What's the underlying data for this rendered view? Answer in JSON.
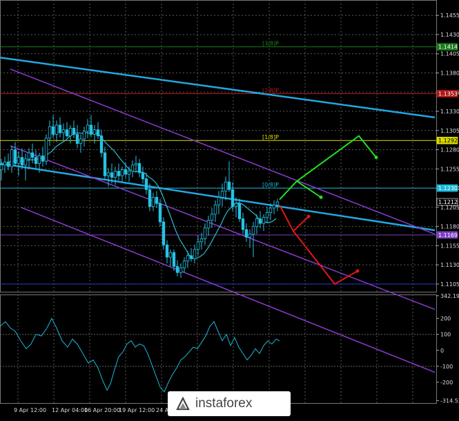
{
  "chart_data": [
    {
      "type": "candlestick",
      "symbol_hint": "EURUSD",
      "timeframe_hint": "H4",
      "grid": true,
      "ylim": [
        1.1095,
        1.1475
      ],
      "y_ticks": [
        "1.1455",
        "1.1430",
        "1.1405",
        "1.1380",
        "1.1355",
        "1.1330",
        "1.1305",
        "1.1280",
        "1.1255",
        "1.1230",
        "1.1205",
        "1.1180",
        "1.1155",
        "1.1130",
        "1.1105"
      ],
      "x_ticks": [
        "9 Apr 12:00",
        "12 Apr 04:00",
        "16 Apr 20:00",
        "19 Apr 12:00",
        "24 Apr"
      ],
      "price_badges": [
        {
          "value": "1.1414",
          "color": "#1a7a1a"
        },
        {
          "value": "1.1353",
          "color": "#b01818"
        },
        {
          "value": "1.1292",
          "color": "#d8d800"
        },
        {
          "value": "1.1230",
          "color": "#18b8d8"
        },
        {
          "value": "1.1212",
          "color": "#000000"
        },
        {
          "value": "1.1169",
          "color": "#7a3fc0"
        }
      ],
      "murray_labels": [
        {
          "text": "[3/8]P",
          "level": 1.1414,
          "color": "#1a8a1a"
        },
        {
          "text": "[2/8]P",
          "level": 1.1353,
          "color": "#c01818"
        },
        {
          "text": "[1/8]P",
          "level": 1.1292,
          "color": "#e0e000"
        },
        {
          "text": "[0/8]P",
          "level": 1.123,
          "color": "#1fb8d8"
        }
      ],
      "horizontal_levels": [
        {
          "value": 1.1414,
          "color": "#1a7a1a"
        },
        {
          "value": 1.1353,
          "color": "#c01818"
        },
        {
          "value": 1.1292,
          "color": "#e0e000"
        },
        {
          "value": 1.123,
          "color": "#18b8d8"
        },
        {
          "value": 1.1169,
          "color": "#7a3fc0"
        },
        {
          "value": 1.1105,
          "color": "#2233cc"
        }
      ],
      "trend_lines": [
        {
          "color": "#22a8e0",
          "from": [
            0,
            1.14
          ],
          "to": [
            630,
            1.1322
          ]
        },
        {
          "color": "#22a8e0",
          "from": [
            0,
            1.1262
          ],
          "to": [
            630,
            1.1175
          ]
        },
        {
          "color": "#8a3cd0",
          "from": [
            15,
            1.1385
          ],
          "to": [
            630,
            1.117
          ]
        },
        {
          "color": "#8a3cd0",
          "from": [
            15,
            1.1285
          ],
          "to": [
            630,
            1.1072
          ]
        },
        {
          "color": "#8a3cd0",
          "from": [
            30,
            1.1205
          ],
          "to": [
            630,
            1.099
          ]
        }
      ],
      "forecast_arrows": [
        {
          "color": "#22e022",
          "points": [
            [
              405,
              1.1215
            ],
            [
              430,
              1.1239
            ],
            [
              465,
              1.1218
            ]
          ]
        },
        {
          "color": "#22e022",
          "points": [
            [
              430,
              1.1239
            ],
            [
              520,
              1.1298
            ],
            [
              545,
              1.127
            ]
          ]
        },
        {
          "color": "#e01818",
          "points": [
            [
              405,
              1.1208
            ],
            [
              425,
              1.1174
            ],
            [
              447,
              1.1193
            ]
          ]
        },
        {
          "color": "#e01818",
          "points": [
            [
              425,
              1.1174
            ],
            [
              485,
              1.1105
            ],
            [
              518,
              1.1122
            ]
          ]
        }
      ],
      "candles": [
        [
          0,
          1.1254,
          1.1268,
          1.124,
          1.126
        ],
        [
          5,
          1.126,
          1.1271,
          1.125,
          1.1264
        ],
        [
          10,
          1.1264,
          1.1275,
          1.1253,
          1.1258
        ],
        [
          15,
          1.1258,
          1.1285,
          1.125,
          1.128
        ],
        [
          20,
          1.128,
          1.129,
          1.1258,
          1.1262
        ],
        [
          25,
          1.1262,
          1.1278,
          1.1246,
          1.127
        ],
        [
          30,
          1.127,
          1.1282,
          1.1255,
          1.126
        ],
        [
          35,
          1.126,
          1.1275,
          1.124,
          1.1268
        ],
        [
          40,
          1.1268,
          1.1282,
          1.1255,
          1.1276
        ],
        [
          45,
          1.1276,
          1.1288,
          1.1262,
          1.127
        ],
        [
          50,
          1.127,
          1.128,
          1.1255,
          1.1262
        ],
        [
          55,
          1.1262,
          1.1276,
          1.125,
          1.1272
        ],
        [
          60,
          1.1272,
          1.1284,
          1.1258,
          1.1265
        ],
        [
          65,
          1.1265,
          1.13,
          1.126,
          1.1295
        ],
        [
          70,
          1.1295,
          1.1318,
          1.1285,
          1.131
        ],
        [
          75,
          1.131,
          1.1325,
          1.1295,
          1.13
        ],
        [
          80,
          1.13,
          1.1318,
          1.129,
          1.1312
        ],
        [
          85,
          1.1312,
          1.1322,
          1.1296,
          1.1302
        ],
        [
          90,
          1.1302,
          1.1314,
          1.1292,
          1.1306
        ],
        [
          95,
          1.1306,
          1.1316,
          1.1296,
          1.1298
        ],
        [
          100,
          1.1298,
          1.1312,
          1.1288,
          1.1308
        ],
        [
          105,
          1.1308,
          1.1318,
          1.1295,
          1.13
        ],
        [
          110,
          1.13,
          1.1312,
          1.1282,
          1.1288
        ],
        [
          115,
          1.1288,
          1.13,
          1.1276,
          1.1294
        ],
        [
          120,
          1.1294,
          1.131,
          1.1284,
          1.1304
        ],
        [
          125,
          1.1304,
          1.132,
          1.1295,
          1.1312
        ],
        [
          130,
          1.1312,
          1.1325,
          1.1296,
          1.13
        ],
        [
          135,
          1.13,
          1.1312,
          1.1288,
          1.1306
        ],
        [
          140,
          1.1306,
          1.1316,
          1.1294,
          1.1298
        ],
        [
          145,
          1.1298,
          1.1306,
          1.127,
          1.1276
        ],
        [
          150,
          1.1276,
          1.1284,
          1.124,
          1.1246
        ],
        [
          155,
          1.1246,
          1.1256,
          1.1232,
          1.125
        ],
        [
          160,
          1.125,
          1.1262,
          1.1236,
          1.1244
        ],
        [
          165,
          1.1244,
          1.1258,
          1.1234,
          1.1252
        ],
        [
          170,
          1.1252,
          1.1262,
          1.124,
          1.1246
        ],
        [
          175,
          1.1246,
          1.1258,
          1.1238,
          1.1254
        ],
        [
          180,
          1.1254,
          1.1264,
          1.1242,
          1.1248
        ],
        [
          185,
          1.1248,
          1.1258,
          1.1238,
          1.1252
        ],
        [
          190,
          1.1252,
          1.1266,
          1.1244,
          1.126
        ],
        [
          195,
          1.126,
          1.1272,
          1.125,
          1.1262
        ],
        [
          200,
          1.1262,
          1.1268,
          1.1244,
          1.125
        ],
        [
          205,
          1.125,
          1.1258,
          1.1236,
          1.1242
        ],
        [
          210,
          1.1242,
          1.125,
          1.1222,
          1.1228
        ],
        [
          215,
          1.1228,
          1.1236,
          1.12,
          1.1206
        ],
        [
          220,
          1.1206,
          1.1224,
          1.12,
          1.1218
        ],
        [
          225,
          1.1218,
          1.1226,
          1.1204,
          1.121
        ],
        [
          230,
          1.121,
          1.1216,
          1.118,
          1.1186
        ],
        [
          235,
          1.1186,
          1.1192,
          1.115,
          1.1156
        ],
        [
          240,
          1.1156,
          1.1162,
          1.1132,
          1.114
        ],
        [
          245,
          1.114,
          1.115,
          1.1128,
          1.1146
        ],
        [
          250,
          1.1146,
          1.115,
          1.1122,
          1.1128
        ],
        [
          255,
          1.1128,
          1.1136,
          1.1115,
          1.112
        ],
        [
          260,
          1.112,
          1.1132,
          1.1113,
          1.1126
        ],
        [
          265,
          1.1126,
          1.114,
          1.112,
          1.1135
        ],
        [
          270,
          1.1135,
          1.1148,
          1.1126,
          1.1142
        ],
        [
          275,
          1.1142,
          1.1152,
          1.1134,
          1.1138
        ],
        [
          280,
          1.1138,
          1.1156,
          1.1132,
          1.115
        ],
        [
          285,
          1.115,
          1.1168,
          1.1142,
          1.116
        ],
        [
          290,
          1.116,
          1.1172,
          1.115,
          1.1164
        ],
        [
          295,
          1.1164,
          1.1184,
          1.1156,
          1.1178
        ],
        [
          300,
          1.1178,
          1.1194,
          1.1168,
          1.1188
        ],
        [
          305,
          1.1188,
          1.1204,
          1.1178,
          1.1196
        ],
        [
          310,
          1.1196,
          1.1214,
          1.1186,
          1.1208
        ],
        [
          315,
          1.1208,
          1.1226,
          1.1196,
          1.1218
        ],
        [
          320,
          1.1218,
          1.1236,
          1.1206,
          1.1226
        ],
        [
          325,
          1.1226,
          1.1245,
          1.1214,
          1.1238
        ],
        [
          330,
          1.1238,
          1.1265,
          1.1225,
          1.1228
        ],
        [
          335,
          1.1228,
          1.1238,
          1.12,
          1.1206
        ],
        [
          340,
          1.1206,
          1.1218,
          1.1192,
          1.121
        ],
        [
          345,
          1.121,
          1.1216,
          1.1186,
          1.119
        ],
        [
          350,
          1.119,
          1.1198,
          1.117,
          1.1176
        ],
        [
          355,
          1.1176,
          1.1184,
          1.116,
          1.1166
        ],
        [
          360,
          1.1166,
          1.1176,
          1.1152,
          1.117
        ],
        [
          365,
          1.117,
          1.1186,
          1.114,
          1.118
        ],
        [
          370,
          1.118,
          1.1196,
          1.117,
          1.119
        ],
        [
          375,
          1.119,
          1.12,
          1.1178,
          1.1184
        ],
        [
          380,
          1.1184,
          1.1196,
          1.1174,
          1.1192
        ],
        [
          385,
          1.1192,
          1.1206,
          1.1184,
          1.1198
        ],
        [
          390,
          1.1198,
          1.121,
          1.1188,
          1.1204
        ],
        [
          395,
          1.1204,
          1.1214,
          1.1196,
          1.1208
        ],
        [
          400,
          1.1208,
          1.1216,
          1.12,
          1.1212
        ]
      ]
    },
    {
      "type": "line",
      "indicator_hint": "CCI",
      "ylim": [
        -330,
        350
      ],
      "y_ticks": [
        "342.1937",
        "200",
        "100",
        "0",
        "-100",
        "-200",
        "-314.5224"
      ],
      "ref_lines": [
        100,
        -100
      ],
      "series": [
        {
          "color": "#1fb8d8",
          "points": [
            [
              0,
              150
            ],
            [
              8,
              180
            ],
            [
              15,
              140
            ],
            [
              22,
              120
            ],
            [
              30,
              60
            ],
            [
              38,
              10
            ],
            [
              45,
              40
            ],
            [
              52,
              100
            ],
            [
              60,
              90
            ],
            [
              68,
              140
            ],
            [
              75,
              200
            ],
            [
              82,
              140
            ],
            [
              90,
              60
            ],
            [
              98,
              20
            ],
            [
              105,
              70
            ],
            [
              112,
              40
            ],
            [
              120,
              -20
            ],
            [
              128,
              -80
            ],
            [
              135,
              -60
            ],
            [
              142,
              -110
            ],
            [
              148,
              -180
            ],
            [
              155,
              -250
            ],
            [
              160,
              -210
            ],
            [
              166,
              -120
            ],
            [
              172,
              -40
            ],
            [
              178,
              -10
            ],
            [
              184,
              40
            ],
            [
              190,
              60
            ],
            [
              196,
              20
            ],
            [
              202,
              40
            ],
            [
              208,
              30
            ],
            [
              214,
              -20
            ],
            [
              220,
              -90
            ],
            [
              226,
              -160
            ],
            [
              232,
              -230
            ],
            [
              238,
              -260
            ],
            [
              244,
              -200
            ],
            [
              250,
              -150
            ],
            [
              256,
              -110
            ],
            [
              262,
              -60
            ],
            [
              268,
              -40
            ],
            [
              274,
              -10
            ],
            [
              280,
              20
            ],
            [
              286,
              10
            ],
            [
              292,
              50
            ],
            [
              298,
              90
            ],
            [
              304,
              150
            ],
            [
              310,
              180
            ],
            [
              316,
              120
            ],
            [
              322,
              60
            ],
            [
              328,
              100
            ],
            [
              334,
              30
            ],
            [
              340,
              80
            ],
            [
              346,
              20
            ],
            [
              352,
              -20
            ],
            [
              358,
              -60
            ],
            [
              364,
              -30
            ],
            [
              370,
              10
            ],
            [
              376,
              -20
            ],
            [
              382,
              30
            ],
            [
              388,
              60
            ],
            [
              394,
              40
            ],
            [
              400,
              70
            ],
            [
              405,
              60
            ]
          ]
        }
      ]
    }
  ],
  "watermark": {
    "text": "instaforex",
    "logo_icon": "instaforex-logo-icon"
  }
}
